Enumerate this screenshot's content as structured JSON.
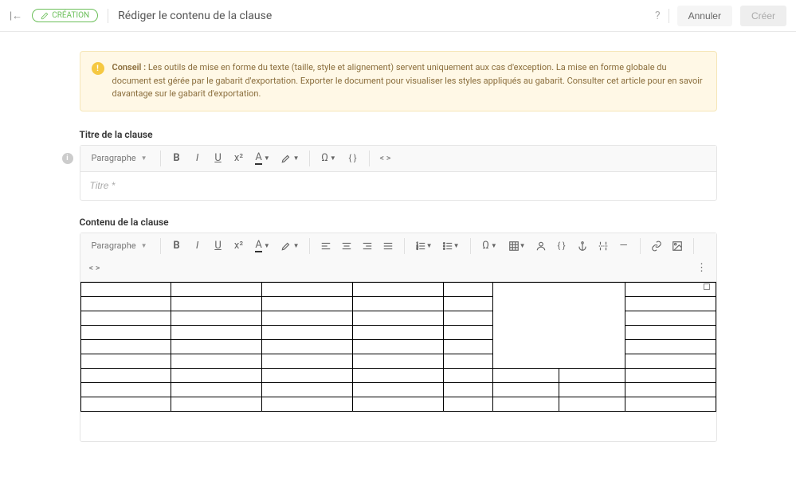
{
  "header": {
    "badge_label": "CRÉATION",
    "page_title": "Rédiger le contenu de la clause",
    "cancel_label": "Annuler",
    "create_label": "Créer"
  },
  "alert": {
    "strong": "Conseil :",
    "text": "Les outils de mise en forme du texte (taille, style et alignement) servent uniquement aux cas d'exception. La mise en forme globale du document est gérée par le gabarit d'exportation. Exporter le document pour visualiser les styles appliqués au gabarit. Consulter cet article pour en savoir davantage sur le gabarit d'exportation."
  },
  "title_section": {
    "label": "Titre de la clause",
    "paragraph_label": "Paragraphe",
    "placeholder": "Titre *"
  },
  "content_section": {
    "label": "Contenu de la clause",
    "paragraph_label": "Paragraphe"
  },
  "toolbar": {
    "bold": "B",
    "italic": "I",
    "underline": "U",
    "super": "x²",
    "font_color": "A",
    "highlight": "�",
    "omega": "Ω",
    "braces": "{ }",
    "code": "< >"
  },
  "table": {
    "rows": 9,
    "cols": 8
  }
}
